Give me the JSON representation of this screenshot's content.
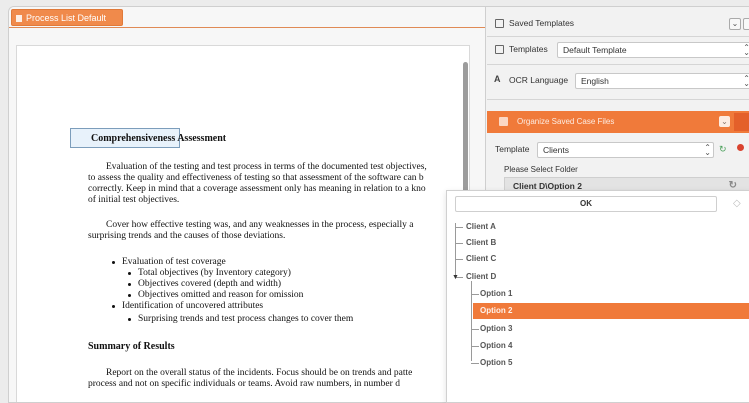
{
  "document": {
    "tab_label": "Process List Default",
    "heading1": "Comprehensiveness Assessment",
    "para1": [
      "Evaluation of the testing and test process in terms of the documented test objectives,",
      "to assess the quality and effectiveness of testing so that assessment of the software can b",
      "correctly. Keep in mind that a coverage assessment only has meaning in relation to a kno",
      "of initial test objectives."
    ],
    "para2": [
      "Cover how effective testing was, and any weaknesses in the process, especially a",
      "surprising trends and the causes of those deviations."
    ],
    "bullets": [
      "Evaluation of test coverage",
      "Total objectives (by Inventory category)",
      "Objectives covered (depth and width)",
      "Objectives omitted and reason for omission",
      "Identification of uncovered attributes",
      "Surprising trends and test process changes to cover them"
    ],
    "heading2": "Summary of Results",
    "para3": [
      "Report on the overall status of the incidents. Focus should be on trends and patte",
      "process and not on specific individuals or teams. Avoid raw numbers, in number d"
    ]
  },
  "panel": {
    "saved_templates_label": "Saved Templates",
    "templates_label": "Templates",
    "templates_value": "Default Template",
    "ocr_label": "OCR Language",
    "ocr_value": "English",
    "section_title": "Organize Saved Case Files",
    "template_label": "Template",
    "template_value": "Clients",
    "folder_prompt": "Please Select Folder",
    "folder_value": "Client D\\Option 2"
  },
  "dropdown": {
    "ok_label": "OK",
    "items": [
      "Client A",
      "Client B",
      "Client C",
      "Client D",
      "Option 1",
      "Option 2",
      "Option 3",
      "Option 4",
      "Option 5"
    ],
    "selected": "Option 2"
  },
  "colors": {
    "accent": "#f07a3a",
    "doc_background": "#ffffff"
  }
}
